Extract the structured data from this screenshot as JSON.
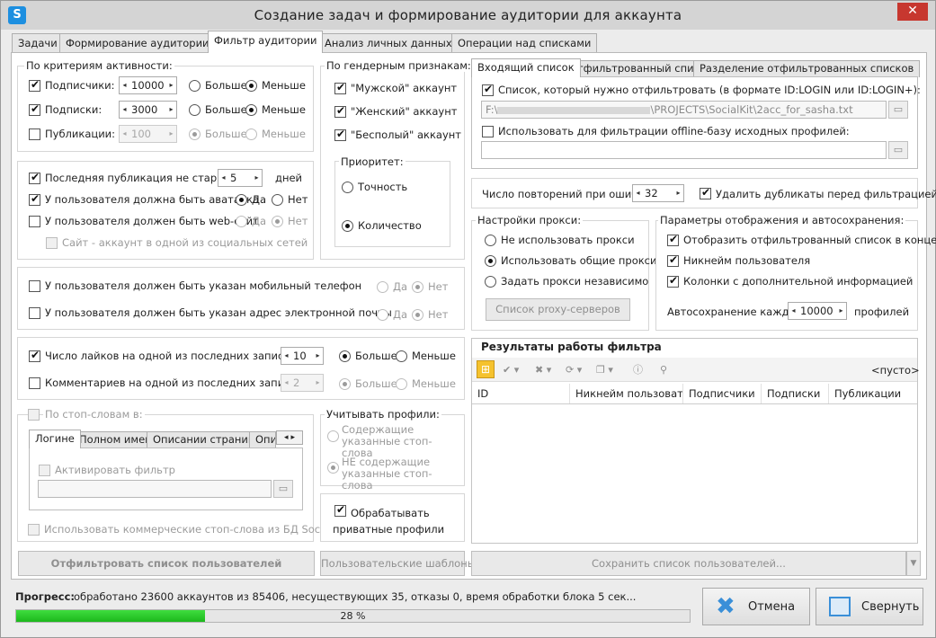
{
  "window": {
    "title": "Создание задач и формирование аудитории для аккаунта"
  },
  "tabs": [
    "Задачи",
    "Формирование аудитории",
    "Фильтр аудитории",
    "Анализ личных данных",
    "Операции над списками"
  ],
  "activity": {
    "title": "По критериям активности:",
    "more": "Больше",
    "less": "Меньше",
    "rows": [
      {
        "label": "Подписчики:",
        "value": "10000"
      },
      {
        "label": "Подписки:",
        "value": "3000"
      },
      {
        "label": "Публикации:",
        "value": "100"
      }
    ]
  },
  "publication": {
    "last_post": "Последняя публикация не старше:",
    "days_value": "5",
    "days_unit": "дней",
    "avatar": "У пользователя должна быть аватарка",
    "website": "У пользователя должен быть web-сайт",
    "social": "Сайт - аккаунт в одной из социальных сетей",
    "yes": "Да",
    "no": "Нет"
  },
  "gender": {
    "title": "По гендерным признакам:",
    "items": [
      "\"Мужской\" аккаунт",
      "\"Женский\" аккаунт",
      "\"Бесполый\" аккаунт"
    ],
    "priority_title": "Приоритет:",
    "priority": [
      "Точность",
      "Количество"
    ]
  },
  "contacts": {
    "phone": "У пользователя должен быть указан мобильный телефон",
    "email": "У пользователя должен быть указан адрес электронной почты",
    "yes": "Да",
    "no": "Нет"
  },
  "likes": {
    "likes_label": "Число лайков на одной из последних записей:",
    "likes_value": "10",
    "comments_label": "Комментариев на одной из последних записей:",
    "comments_value": "2",
    "more": "Больше",
    "less": "Меньше"
  },
  "stopwords": {
    "title": "По стоп-словам в:",
    "tabs": [
      "Логине",
      "Полном имени",
      "Описании страницы",
      "Опис"
    ],
    "activate": "Активировать фильтр",
    "commercial": "Использовать коммерческие стоп-слова из БД SocialKit"
  },
  "profiles": {
    "title": "Учитывать профили:",
    "with": "Содержащие указанные стоп-слова",
    "without": "НЕ содержащие указанные стоп-слова",
    "private": "Обрабатывать приватные профили"
  },
  "buttons": {
    "filter": "Отфильтровать список пользователей",
    "templates": "Пользовательские шаблоны",
    "save": "Сохранить список пользователей..."
  },
  "input": {
    "tabs": [
      "Входящий список",
      "Отфильтрованный список",
      "Разделение отфильтрованных списков"
    ],
    "list_label": "Список, который нужно отфильтровать (в формате ID:LOGIN или ID:LOGIN+):",
    "path_prefix": "F:\\",
    "path_suffix": "\\PROJECTS\\SocialKit\\2acc_for_sasha.txt",
    "offline_label": "Использовать для фильтрации offline-базу исходных профилей:"
  },
  "retry": {
    "label": "Число повторений при ошибке:",
    "value": "32",
    "dedupe": "Удалить дубликаты перед фильтрацией"
  },
  "proxy": {
    "title": "Настройки прокси:",
    "options": [
      "Не использовать прокси",
      "Использовать общие прокси",
      "Задать прокси независимо"
    ],
    "list_button": "Список proxy-серверов"
  },
  "display": {
    "title": "Параметры отображения и автосохранения:",
    "options": [
      "Отобразить отфильтрованный список в конце",
      "Никнейм пользователя",
      "Колонки с дополнительной информацией"
    ],
    "autosave_label": "Автосохранение каждые",
    "autosave_value": "10000",
    "autosave_unit": "профилей"
  },
  "results": {
    "title": "Результаты работы фильтра",
    "empty": "<пусто>",
    "columns": [
      "ID",
      "Никнейм пользоват...",
      "Подписчики",
      "Подписки",
      "Публикации"
    ]
  },
  "progress": {
    "label": "Прогресс:",
    "text": "обработано 23600 аккаунтов из 85406, несуществующих 35, отказы 0, время обработки блока 5 сек...",
    "percent": 28,
    "percent_text": "28 %"
  },
  "footer": {
    "cancel": "Отмена",
    "minimize": "Свернуть"
  }
}
